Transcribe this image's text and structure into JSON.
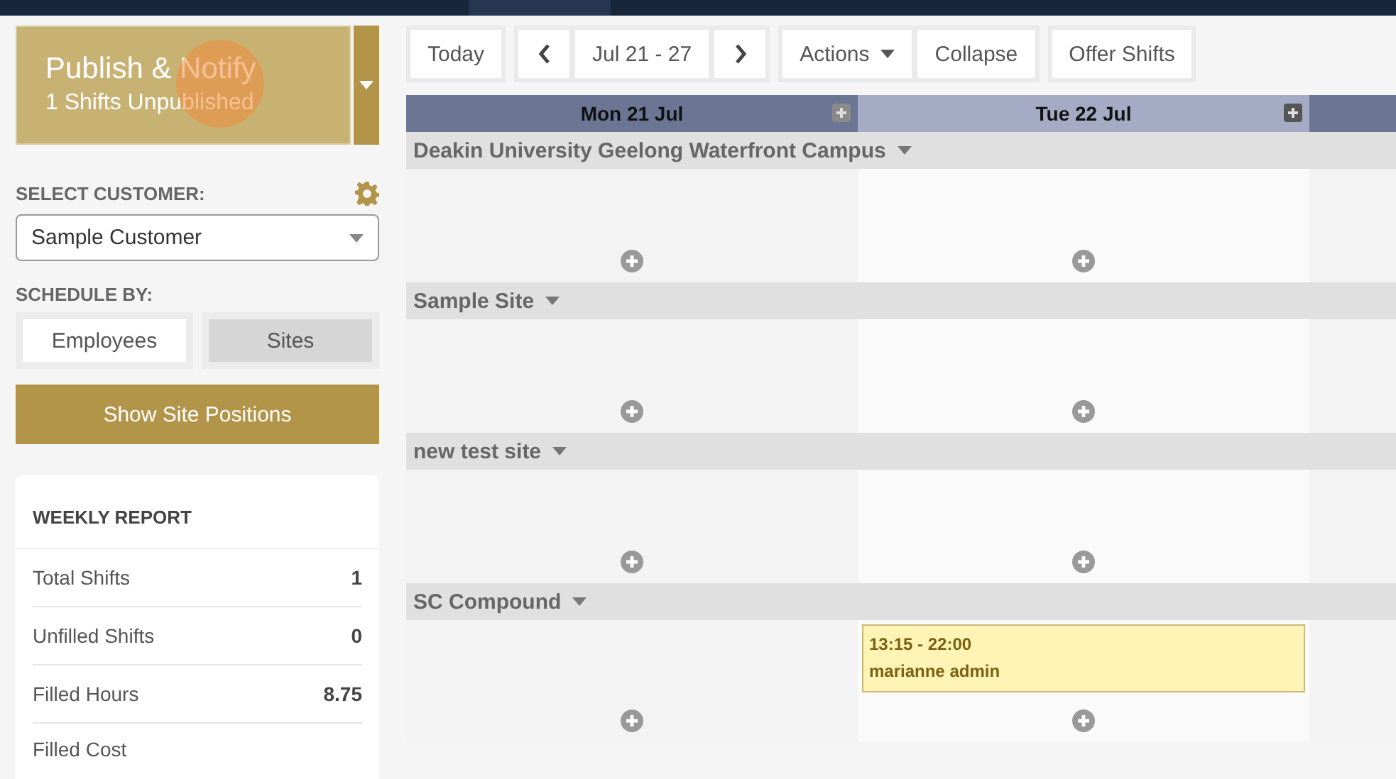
{
  "publish": {
    "title": "Publish & Notify",
    "subtitle": "1 Shifts Unpublished"
  },
  "customer": {
    "label": "SELECT CUSTOMER:",
    "value": "Sample Customer"
  },
  "schedule_by": {
    "label": "SCHEDULE BY:",
    "options": [
      {
        "label": "Employees",
        "selected": false
      },
      {
        "label": "Sites",
        "selected": true
      }
    ]
  },
  "show_positions": "Show Site Positions",
  "weekly_report": {
    "title": "WEEKLY REPORT",
    "rows": [
      {
        "label": "Total Shifts",
        "value": "1"
      },
      {
        "label": "Unfilled Shifts",
        "value": "0"
      },
      {
        "label": "Filled Hours",
        "value": "8.75"
      },
      {
        "label": "Filled Cost"
      }
    ]
  },
  "toolbar": {
    "today": "Today",
    "range": "Jul 21 - 27",
    "actions": "Actions",
    "collapse": "Collapse",
    "offer": "Offer Shifts"
  },
  "days": [
    {
      "label": "Mon 21 Jul",
      "selected": false
    },
    {
      "label": "Tue 22 Jul",
      "selected": true
    }
  ],
  "sites": [
    {
      "name": "Deakin University Geelong Waterfront Campus",
      "cells": [
        {
          "kind": "empty"
        },
        {
          "kind": "empty"
        }
      ]
    },
    {
      "name": "Sample Site",
      "cells": [
        {
          "kind": "empty"
        },
        {
          "kind": "empty"
        }
      ]
    },
    {
      "name": "new test site",
      "cells": [
        {
          "kind": "empty"
        },
        {
          "kind": "empty"
        }
      ]
    },
    {
      "name": "SC Compound",
      "cells": [
        {
          "kind": "empty"
        },
        {
          "kind": "shifts",
          "shifts": [
            {
              "time": "13:15 - 22:00",
              "employee": "marianne admin"
            }
          ]
        }
      ]
    }
  ]
}
